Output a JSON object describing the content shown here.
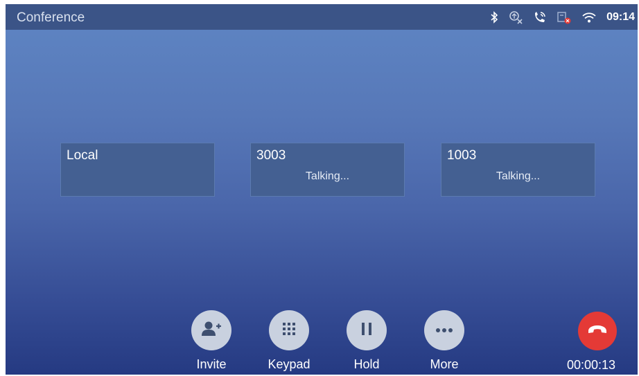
{
  "header": {
    "title": "Conference",
    "time": "09:14"
  },
  "status_icons": [
    "bluetooth-icon",
    "network-disconnected-icon",
    "call-forward-icon",
    "usb-error-icon",
    "wifi-icon"
  ],
  "participants": [
    {
      "name": "Local",
      "status": ""
    },
    {
      "name": "3003",
      "status": "Talking..."
    },
    {
      "name": "1003",
      "status": "Talking..."
    }
  ],
  "actions": {
    "invite": "Invite",
    "keypad": "Keypad",
    "hold": "Hold",
    "more": "More"
  },
  "call": {
    "duration": "00:00:13"
  },
  "colors": {
    "statusbar": "#3b5487",
    "button": "#c9d1df",
    "end_call": "#e43a36"
  }
}
